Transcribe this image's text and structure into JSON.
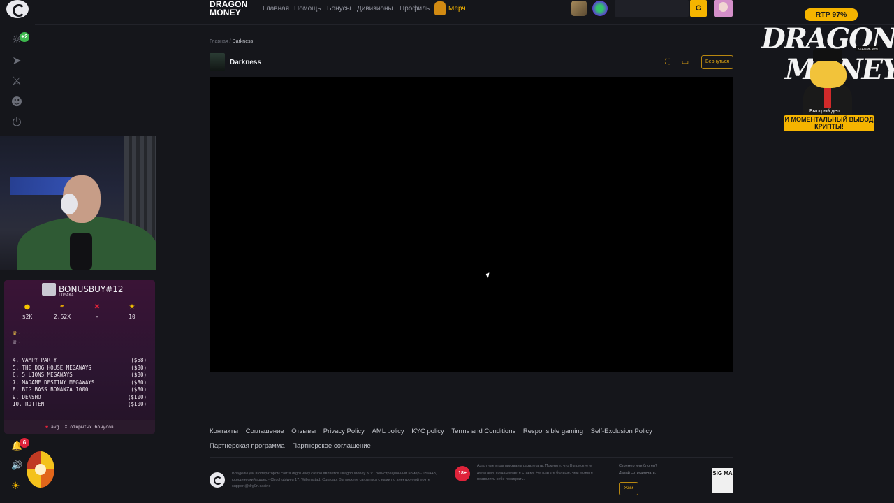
{
  "nav": {
    "brand_line1": "DRAGON",
    "brand_line2": "MONEY",
    "items": [
      "Главная",
      "Помощь",
      "Бонусы",
      "Дивизионы",
      "Профиль"
    ],
    "merch": "Мерч",
    "wallet_btn": "G"
  },
  "sidebar": {
    "badge_plus": "+2",
    "icons": [
      "rewards-icon",
      "rocket-icon",
      "tournament-icon",
      "user-icon",
      "power-icon"
    ],
    "bell_badge": "6"
  },
  "breadcrumb": {
    "home": "Главная",
    "sep": "/",
    "current": "Darkness"
  },
  "game": {
    "title": "Darkness",
    "back_label": "Вернуться"
  },
  "footer": {
    "links": [
      "Контакты",
      "Соглашение",
      "Отзывы",
      "Privacy Policy",
      "AML policy",
      "KYC policy",
      "Terms and Conditions",
      "Responsible gaming",
      "Self-Exclusion Policy",
      "Партнерская программа",
      "Партнерское соглашение"
    ],
    "legal": "Владельцем и оператором сайта drgn19ney.casino является Dragon Money N.V., регистрационный номер - 159443, юридический адрес - Chuchubiweg 17, Willemstad, Curaçao. Вы можете связаться с нами по электронной почте support@drg0n.casino",
    "age": "18+",
    "gamble_note": "Азартные игры призваны развлекать. Помните, что Вы рискуете деньгами, когда делаете ставки. Не тратьте больше, чем можете позволить себе проиграть.",
    "streamer_q": "Стример или блогер?",
    "streamer_sub": "Давай сотрудничать.",
    "write_btn": "Жми",
    "sigma": "SIG MA"
  },
  "bonus_panel": {
    "title": "BONUSBUY#12",
    "subtitle": "LOMAKA",
    "stats": [
      {
        "icon": "coin-icon",
        "value": "$2K",
        "color": "#f5c400"
      },
      {
        "icon": "headphones-icon",
        "value": "2.52X",
        "color": "#f5b400"
      },
      {
        "icon": "cross-icon",
        "value": "-",
        "color": "#e0233a"
      },
      {
        "icon": "star-icon",
        "value": "10",
        "color": "#f5c400"
      }
    ],
    "crowns": [
      "-",
      "-"
    ],
    "items": [
      {
        "name": "4. VAMPY PARTY",
        "price": "($58)"
      },
      {
        "name": "5. THE DOG HOUSE MEGAWAYS",
        "price": "($80)"
      },
      {
        "name": "6. 5 LIONS MEGAWAYS",
        "price": "($80)"
      },
      {
        "name": "7. MADAME DESTINY MEGAWAYS",
        "price": "($80)"
      },
      {
        "name": "8. BIG BASS BONANZA 1000",
        "price": "($80)"
      },
      {
        "name": "9. DENSHO",
        "price": "($100)"
      },
      {
        "name": "10. ROTTEN",
        "price": "($100)"
      }
    ],
    "footer": "avg. X открытых бонусов"
  },
  "promo": {
    "rtp": "RTP 97%",
    "word1": "DRAGON",
    "word2": "MONEY",
    "cashback": "КЕШБЭК 10%",
    "tag1": "Быстрый деп",
    "tag2": "И МОМЕНТАЛЬНЫЙ ВЫВОД КРИПТЫ!"
  }
}
